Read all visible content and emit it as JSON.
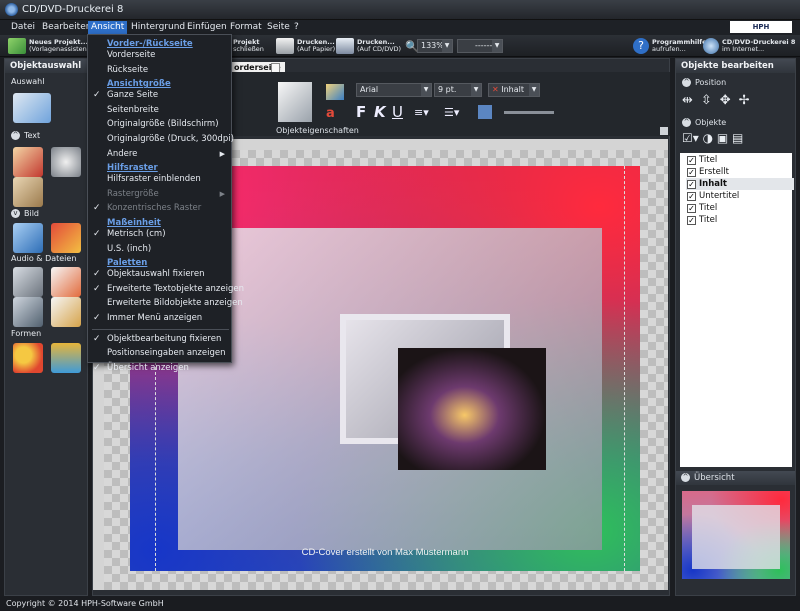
{
  "window": {
    "title": "CD/DVD-Druckerei 8"
  },
  "menu": [
    "Datei",
    "Bearbeiten",
    "Ansicht",
    "Hintergrund",
    "Einfügen",
    "Format",
    "Seite",
    "?"
  ],
  "brand": "HPH SOFTWARE",
  "toolbar": {
    "new_project": "Neues Projekt...",
    "new_project_sub": "(Vorlagenassisten",
    "close_project": "Projekt",
    "close_project_sub": "schließen",
    "print_paper": "Drucken...",
    "print_paper_sub": "(Auf Papier)",
    "print_cd": "Drucken...",
    "print_cd_sub": "(Auf CD/DVD)",
    "zoom": "133%",
    "linestyle": "------",
    "help": "Programmhilfe",
    "help_sub": "aufrufen...",
    "web": "CD/DVD-Druckerei 8",
    "web_sub": "im Internet..."
  },
  "left_panel": {
    "title": "Objektauswahl",
    "sections": [
      "Auswahl",
      "Text",
      "Bild",
      "Audio & Dateien",
      "Formen"
    ]
  },
  "document": {
    "tab": "orderseite",
    "prop_label": "Objekteigenschaften",
    "font": "Arial",
    "size": "9 pt.",
    "field": "Inhalt",
    "caption": "CD-Cover erstellt von Max Mustermann"
  },
  "right_panel": {
    "title": "Objekte bearbeiten",
    "position_label": "Position",
    "objects_label": "Objekte",
    "objects": [
      "Titel",
      "Erstellt",
      "Inhalt",
      "Untertitel",
      "Titel",
      "Titel"
    ],
    "selected_index": 2,
    "overview_label": "Übersicht"
  },
  "dropdown": [
    {
      "label": "Vorder-/Rückseite",
      "type": "head"
    },
    {
      "label": "Vorderseite",
      "type": "item"
    },
    {
      "label": "Rückseite",
      "type": "item"
    },
    {
      "label": "Ansichtgröße",
      "type": "head"
    },
    {
      "label": "Ganze Seite",
      "type": "item",
      "checked": true
    },
    {
      "label": "Seitenbreite",
      "type": "item"
    },
    {
      "label": "Originalgröße (Bildschirm)",
      "type": "item"
    },
    {
      "label": "Originalgröße (Druck, 300dpi)",
      "type": "item"
    },
    {
      "label": "Andere",
      "type": "item",
      "submenu": true
    },
    {
      "label": "Hilfsraster",
      "type": "head"
    },
    {
      "label": "Hilfsraster einblenden",
      "type": "item"
    },
    {
      "label": "Rastergröße",
      "type": "disabled",
      "submenu": true
    },
    {
      "label": "Konzentrisches Raster",
      "type": "disabled",
      "checked": true
    },
    {
      "label": "Maßeinheit",
      "type": "head"
    },
    {
      "label": "Metrisch (cm)",
      "type": "item",
      "checked": true
    },
    {
      "label": "U.S. (inch)",
      "type": "item"
    },
    {
      "label": "Paletten",
      "type": "head"
    },
    {
      "label": "Objektauswahl fixieren",
      "type": "item",
      "checked": true
    },
    {
      "label": "Erweiterte Textobjekte anzeigen",
      "type": "item",
      "checked": true
    },
    {
      "label": "Erweiterte Bildobjekte anzeigen",
      "type": "item"
    },
    {
      "label": "Immer Menü anzeigen",
      "type": "item",
      "checked": true
    },
    {
      "label": "",
      "type": "sep"
    },
    {
      "label": "Objektbearbeitung fixieren",
      "type": "item",
      "checked": true
    },
    {
      "label": "Positionseingaben anzeigen",
      "type": "item"
    },
    {
      "label": "Übersicht anzeigen",
      "type": "item",
      "checked": true
    }
  ],
  "status": "Copyright © 2014 HPH-Software GmbH",
  "colors": {
    "accent": "#2e6fc9",
    "menu_head": "#6a9ee6"
  }
}
